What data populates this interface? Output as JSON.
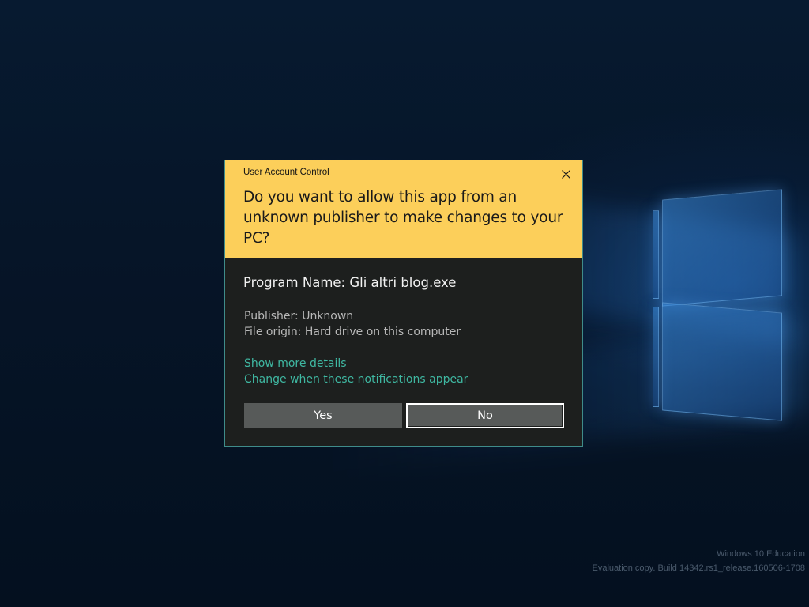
{
  "dialog": {
    "title": "User Account Control",
    "question": "Do you want to allow this app from an unknown publisher to make changes to your PC?",
    "program_name": "Program Name: Gli altri blog.exe",
    "publisher": "Publisher: Unknown",
    "file_origin": "File origin: Hard drive on this computer",
    "links": {
      "show_details": "Show more details",
      "change_notifications": "Change when these notifications appear"
    },
    "buttons": {
      "yes": "Yes",
      "no": "No"
    },
    "colors": {
      "header": "#fccf5a",
      "body": "#1d1f1e",
      "link": "#3fb8a2",
      "button": "#575a59",
      "border": "#3f8c8a"
    }
  },
  "watermark": {
    "edition": "Windows 10 Education",
    "build": "Evaluation copy. Build 14342.rs1_release.160506-1708"
  },
  "icons": {
    "close": "close-icon"
  }
}
